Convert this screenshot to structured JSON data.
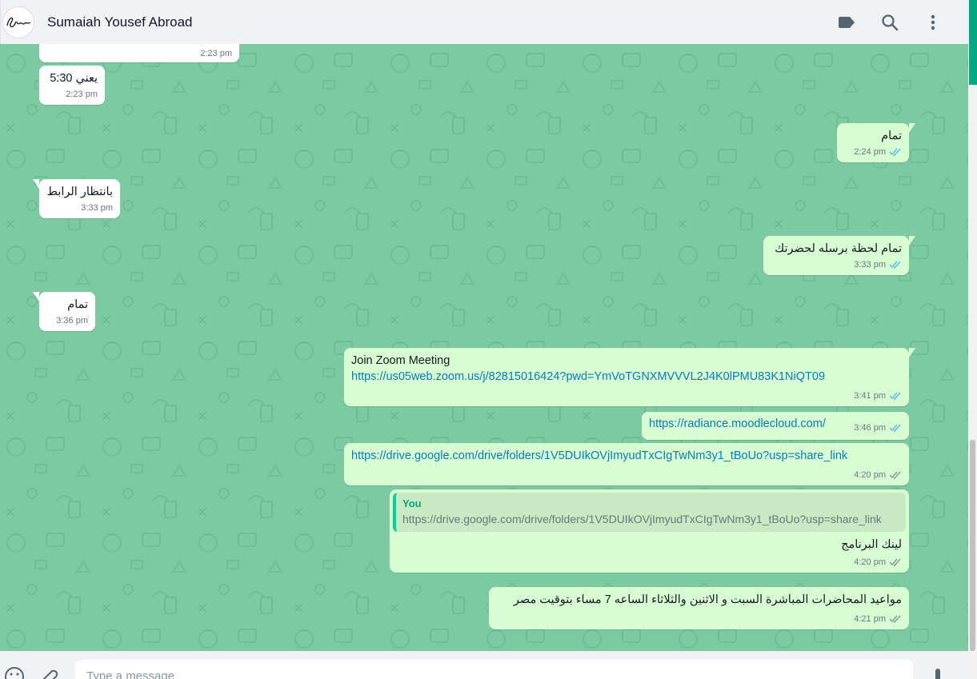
{
  "header": {
    "contact_name": "Sumaiah Yousef Abroad",
    "avatar_text": "Sws",
    "icons": [
      "label-icon",
      "search-icon",
      "menu-icon"
    ]
  },
  "colors": {
    "chat_bg": "#7dc9a2",
    "incoming": "#ffffff",
    "outgoing": "#d9fdd3",
    "link": "#027eb5",
    "read_ticks": "#53bdeb",
    "accent": "#00a884"
  },
  "messages": [
    {
      "direction": "in",
      "text": "",
      "time": "2:23 pm"
    },
    {
      "direction": "in",
      "text": "يعني 5:30",
      "time": "2:23 pm"
    },
    {
      "direction": "out",
      "text": "تمام",
      "time": "2:24 pm",
      "status": "read"
    },
    {
      "direction": "in",
      "text": "بانتظار الرابط",
      "time": "3:33 pm"
    },
    {
      "direction": "out",
      "text": "تمام لحظة برسله لحضرتك",
      "time": "3:33 pm",
      "status": "read"
    },
    {
      "direction": "in",
      "text": "تمام",
      "time": "3:36 pm"
    },
    {
      "direction": "out",
      "text": "Join Zoom Meeting",
      "link": "https://us05web.zoom.us/j/82815016424?pwd=YmVoTGNXMVVVL2J4K0lPMU83K1NiQT09",
      "time": "3:41 pm",
      "status": "read"
    },
    {
      "direction": "out",
      "link": "https://radiance.moodlecloud.com/",
      "time": "3:46 pm",
      "status": "read"
    },
    {
      "direction": "out",
      "link": "https://drive.google.com/drive/folders/1V5DUIkOVjImyudTxCIgTwNm3y1_tBoUo?usp=share_link",
      "time": "4:20 pm",
      "status": "delivered"
    },
    {
      "direction": "out",
      "quote_author": "You",
      "quote_text": "https://drive.google.com/drive/folders/1V5DUIkOVjImyudTxCIgTwNm3y1_tBoUo?usp=share_link",
      "text": "لينك البرنامج",
      "time": "4:20 pm",
      "status": "delivered"
    },
    {
      "direction": "out",
      "text": "مواعيد المحاضرات المباشرة السبت و الاثنين والثلاثاء الساعه 7 مساء بتوقيت مصر",
      "time": "4:21 pm",
      "status": "delivered"
    }
  ],
  "composer": {
    "placeholder": "Type a message",
    "icons": [
      "emoji-icon",
      "attach-icon",
      "microphone-icon"
    ]
  }
}
